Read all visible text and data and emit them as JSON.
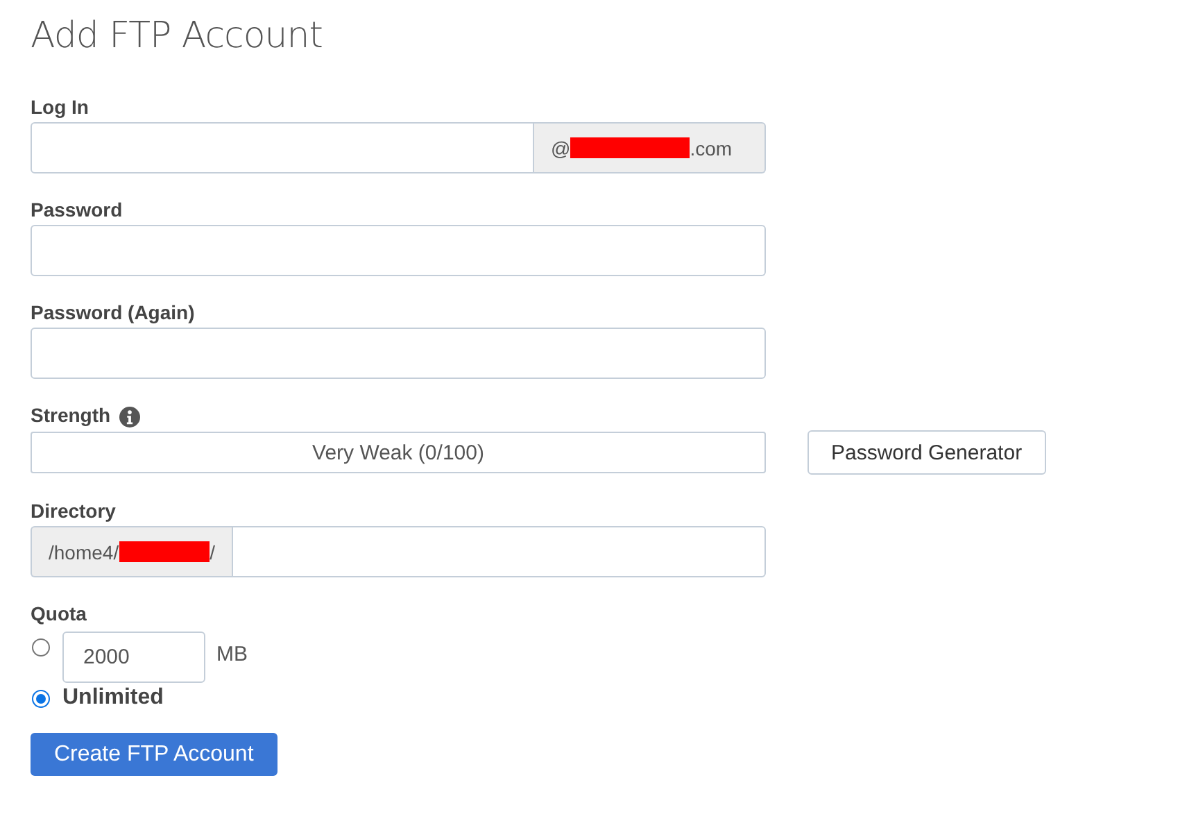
{
  "title": "Add FTP Account",
  "login": {
    "label": "Log In",
    "domain_prefix": "@",
    "domain_redacted": true,
    "domain_suffix": ".com"
  },
  "password": {
    "label": "Password"
  },
  "password_again": {
    "label": "Password (Again)"
  },
  "strength": {
    "label": "Strength",
    "reading": "Very Weak (0/100)",
    "generator_button": "Password Generator"
  },
  "directory": {
    "label": "Directory",
    "prefix": "/home4/",
    "redacted": true,
    "suffix": "/"
  },
  "quota": {
    "label": "Quota",
    "options": [
      {
        "kind": "amount",
        "selected": false,
        "value": "2000",
        "unit": "MB"
      },
      {
        "kind": "unlimited",
        "selected": true,
        "label": "Unlimited"
      }
    ]
  },
  "submit_button": "Create FTP Account"
}
